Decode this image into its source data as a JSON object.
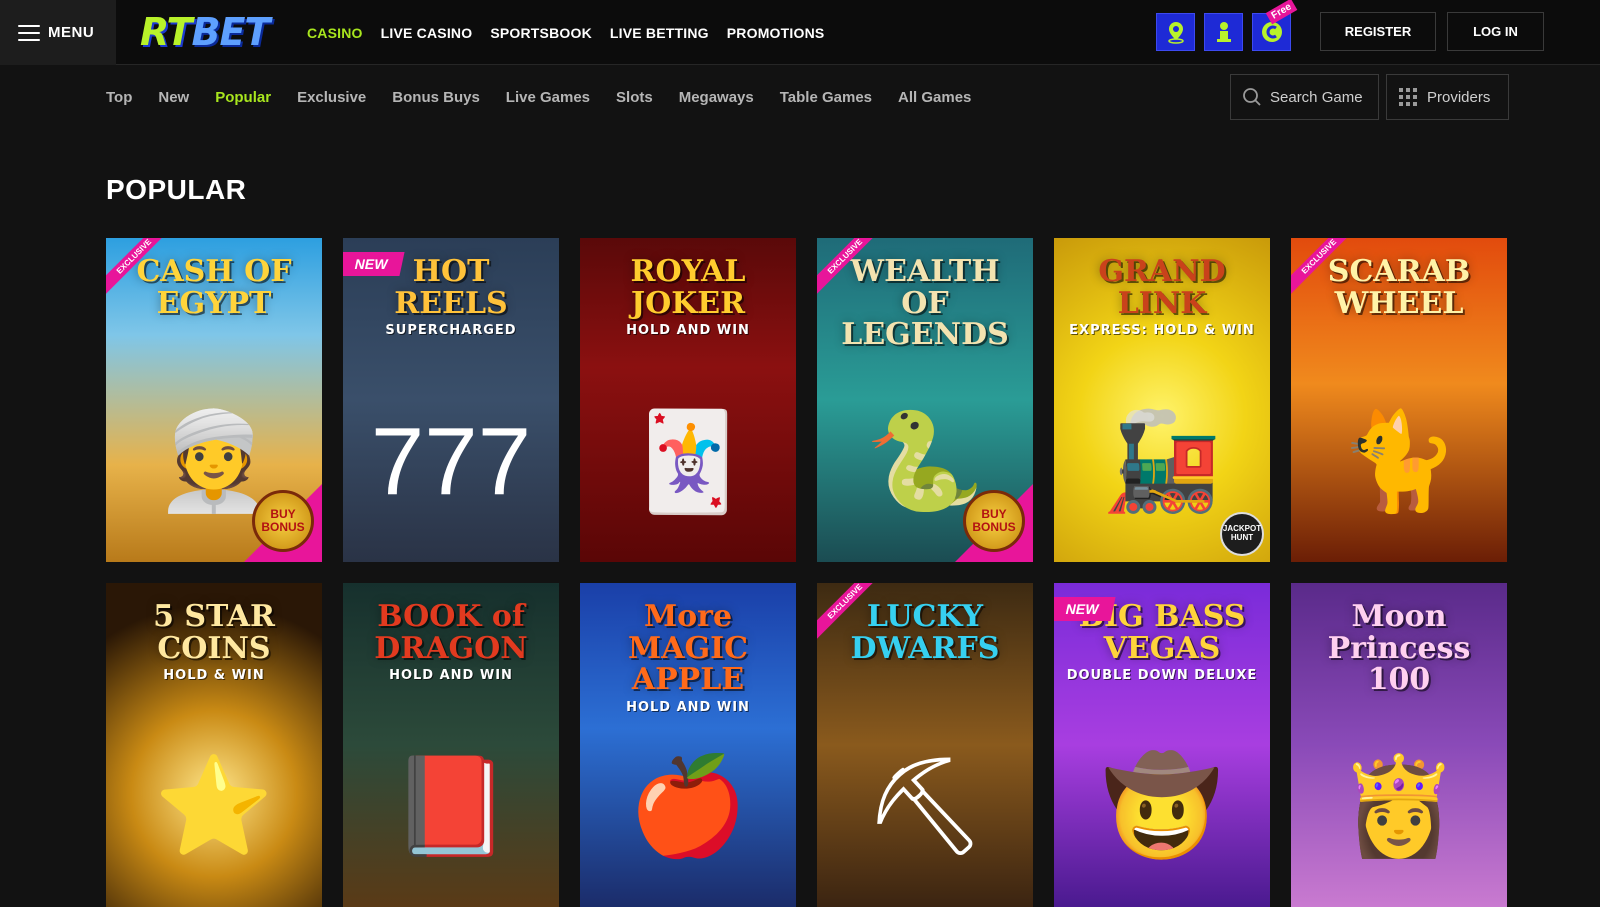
{
  "header": {
    "menu_label": "MENU",
    "logo": {
      "part1": "RT",
      "part2": "BET"
    },
    "nav": [
      {
        "label": "CASINO",
        "active": true
      },
      {
        "label": "LIVE CASINO",
        "active": false
      },
      {
        "label": "SPORTSBOOK",
        "active": false
      },
      {
        "label": "LIVE BETTING",
        "active": false
      },
      {
        "label": "PROMOTIONS",
        "active": false
      }
    ],
    "promo_icons": [
      {
        "icon": "map-pin-icon"
      },
      {
        "icon": "trophy-icon"
      },
      {
        "icon": "coin-icon",
        "ribbon": "Free"
      }
    ],
    "register_label": "REGISTER",
    "login_label": "LOG IN"
  },
  "subnav": {
    "items": [
      {
        "label": "Top",
        "active": false
      },
      {
        "label": "New",
        "active": false
      },
      {
        "label": "Popular",
        "active": true
      },
      {
        "label": "Exclusive",
        "active": false
      },
      {
        "label": "Bonus Buys",
        "active": false
      },
      {
        "label": "Live Games",
        "active": false
      },
      {
        "label": "Slots",
        "active": false
      },
      {
        "label": "Megaways",
        "active": false
      },
      {
        "label": "Table Games",
        "active": false
      },
      {
        "label": "All Games",
        "active": false
      }
    ],
    "search_placeholder": "Search Game",
    "providers_label": "Providers"
  },
  "section": {
    "title": "POPULAR"
  },
  "games": [
    {
      "title": "CASH OF EGYPT",
      "sub": "",
      "badge": "EXCLUSIVE",
      "extra": "BUY BONUS",
      "bg": "linear-gradient(180deg,#2d9fe0 0%,#7fc6e8 30%,#e7b24a 70%,#b87a1a 100%)",
      "art": "👳",
      "color": "#ffd43b"
    },
    {
      "title": "HOT REELS",
      "sub": "SUPERCHARGED",
      "badge": "NEW",
      "extra": "",
      "bg": "linear-gradient(180deg,#2b3e57 0%,#3a4f6a 50%,#2a3346 100%)",
      "art": "777",
      "color": "#ffc23a"
    },
    {
      "title": "ROYAL JOKER",
      "sub": "HOLD AND WIN",
      "badge": "",
      "extra": "",
      "bg": "linear-gradient(180deg,#5a0909 0%,#8b1010 40%,#5a0606 100%)",
      "art": "🃏",
      "color": "#ffcc2e"
    },
    {
      "title": "WEALTH OF LEGENDS",
      "sub": "",
      "badge": "EXCLUSIVE",
      "extra": "BUY BONUS",
      "bg": "linear-gradient(180deg,#1f6b78 0%,#2a9c96 50%,#1b4c52 100%)",
      "art": "🐍",
      "color": "#f3e3b0"
    },
    {
      "title": "GRAND LINK",
      "sub": "EXPRESS: HOLD & WIN",
      "badge": "",
      "extra": "JACKPOT HUNT",
      "bg": "radial-gradient(circle at 50% 55%,#fff36a 0%,#f2d416 40%,#c99a0a 100%)",
      "art": "🚂",
      "color": "#c9421b"
    },
    {
      "title": "SCARAB WHEEL",
      "sub": "",
      "badge": "EXCLUSIVE",
      "extra": "",
      "bg": "linear-gradient(180deg,#e24b0d 0%,#f08a1d 45%,#6b1e06 100%)",
      "art": "🐈",
      "color": "#fff3a8"
    },
    {
      "title": "5 STAR COINS",
      "sub": "HOLD & WIN",
      "badge": "",
      "extra": "",
      "bg": "radial-gradient(circle at 50% 65%,#ffe68a 0%,#c98a14 35%,#2a1706 80%)",
      "art": "⭐",
      "color": "#ffe8a0"
    },
    {
      "title": "BOOK of DRAGON",
      "sub": "HOLD AND WIN",
      "badge": "",
      "extra": "",
      "bg": "linear-gradient(180deg,#16302d 0%,#2c4a3a 50%,#5a3a16 100%)",
      "art": "📕",
      "color": "#e23a1f"
    },
    {
      "title": "More MAGIC APPLE",
      "sub": "HOLD AND WIN",
      "badge": "",
      "extra": "",
      "bg": "linear-gradient(180deg,#1a3fa8 0%,#2c6fd4 45%,#1b2c6a 100%)",
      "art": "🍎",
      "color": "#ff6a1a"
    },
    {
      "title": "LUCKY DWARFS",
      "sub": "",
      "badge": "EXCLUSIVE",
      "extra": "",
      "bg": "linear-gradient(180deg,#3d2a12 0%,#8a5a1d 50%,#3b2411 100%)",
      "art": "⛏",
      "color": "#36d0f0"
    },
    {
      "title": "BIG BASS VEGAS",
      "sub": "DOUBLE DOWN DELUXE",
      "badge": "NEW",
      "extra": "",
      "bg": "linear-gradient(180deg,#7a2bd9 0%,#a83ee0 50%,#4a1a8f 100%)",
      "art": "🤠",
      "color": "#ffd43b"
    },
    {
      "title": "Moon Princess 100",
      "sub": "",
      "badge": "",
      "extra": "",
      "bg": "linear-gradient(180deg,#5a2a8a 0%,#8a4ab8 50%,#c97ad0 100%)",
      "art": "👸",
      "color": "#ffd0f0"
    }
  ]
}
